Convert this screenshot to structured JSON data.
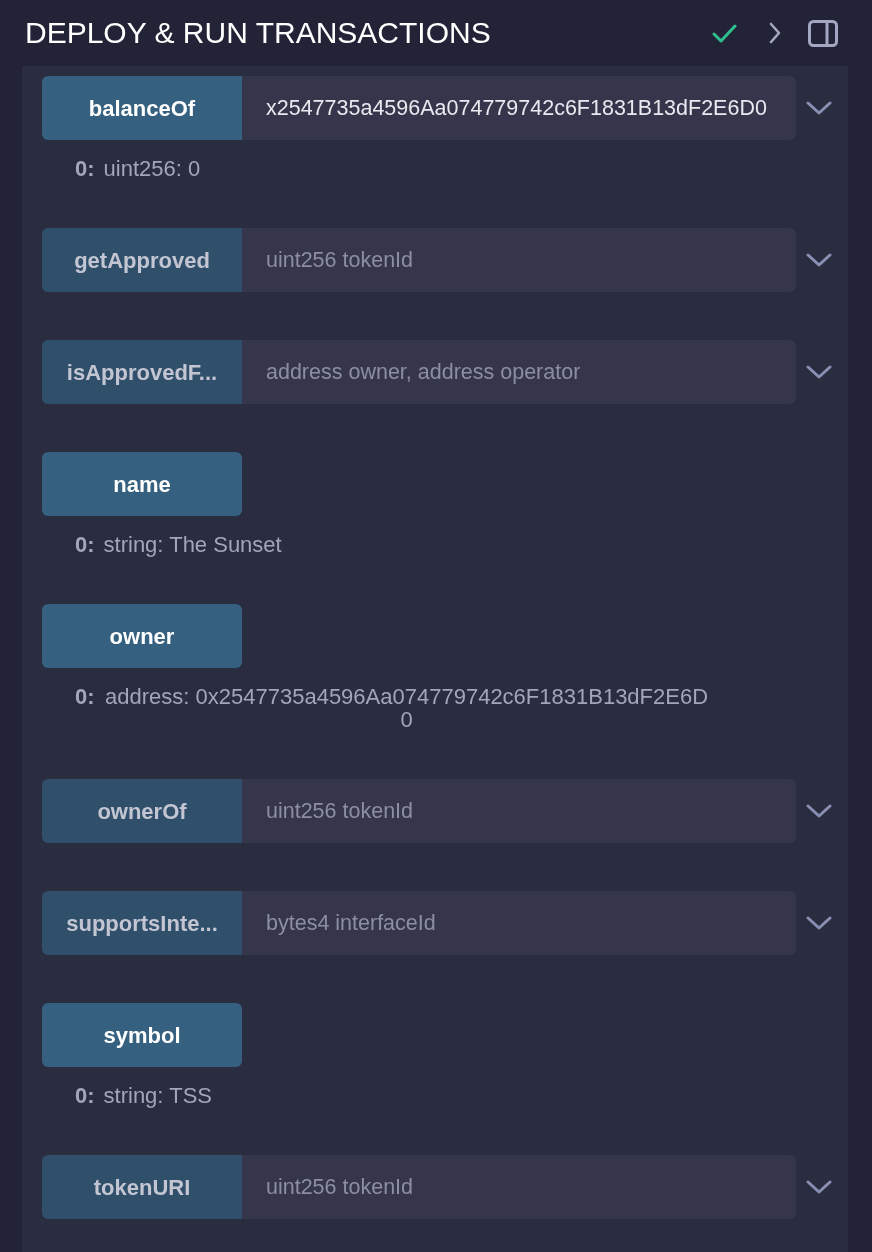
{
  "header": {
    "title": "DEPLOY & RUN TRANSACTIONS"
  },
  "functions": [
    {
      "kind": "with_args",
      "label": "balanceOf",
      "disabled": false,
      "expanded": false,
      "input": {
        "value": "x2547735a4596Aa074779742c6F1831B13dF2E6D0"
      },
      "outputs": [
        {
          "index": "0:",
          "text": "uint256: 0"
        }
      ]
    },
    {
      "kind": "with_args",
      "label": "getApproved",
      "disabled": true,
      "expanded": false,
      "input": {
        "placeholder": "uint256 tokenId"
      }
    },
    {
      "kind": "with_args",
      "label": "isApprovedF...",
      "disabled": true,
      "expanded": false,
      "input": {
        "placeholder": "address owner, address operator"
      }
    },
    {
      "kind": "no_args",
      "label": "name",
      "disabled": false,
      "outputs": [
        {
          "index": "0:",
          "text": "string: The Sunset"
        }
      ]
    },
    {
      "kind": "no_args",
      "label": "owner",
      "disabled": false,
      "outputs": [
        {
          "index": "0:",
          "text": "address: 0x2547735a4596Aa074779742c6F1831B13dF2E6D0"
        }
      ]
    },
    {
      "kind": "with_args",
      "label": "ownerOf",
      "disabled": true,
      "expanded": false,
      "input": {
        "placeholder": "uint256 tokenId"
      }
    },
    {
      "kind": "with_args",
      "label": "supportsInte...",
      "disabled": true,
      "expanded": false,
      "input": {
        "placeholder": "bytes4 interfaceId"
      }
    },
    {
      "kind": "no_args",
      "label": "symbol",
      "disabled": false,
      "outputs": [
        {
          "index": "0:",
          "text": "string: TSS"
        }
      ]
    },
    {
      "kind": "with_args",
      "label": "tokenURI",
      "disabled": true,
      "expanded": false,
      "input": {
        "placeholder": "uint256 tokenId"
      }
    }
  ]
}
